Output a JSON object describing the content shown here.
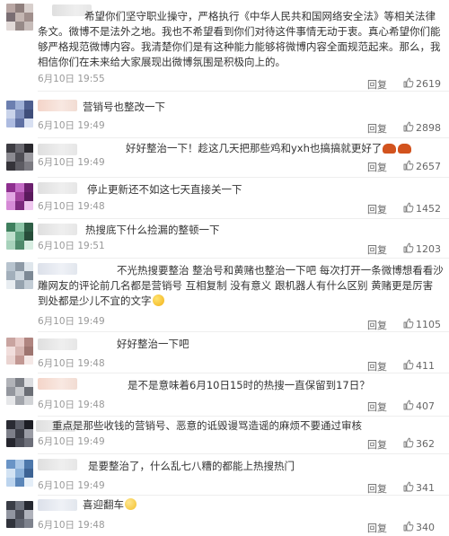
{
  "comments": [
    {
      "text": "希望你们坚守职业操守，严格执行《中华人民共和国网络安全法》等相关法律条文。微博不是法外之地。我也不希望看到你们对待这件事情无动于衷。真心希望你们能够严格规范微博内容。我清楚你们是有这种能力能够将微博内容全面规范起来。那么，我相信你们在未来给大家展现出微博氛围是积极向上的。",
      "time": "6月10日 19:55",
      "reply": "回复",
      "likes": "2619"
    },
    {
      "text": "营销号也整改一下",
      "time": "6月10日 19:49",
      "reply": "回复",
      "likes": "2898"
    },
    {
      "text": "好好整治一下！趁这几天把那些鸡和yxh也搞搞就更好了",
      "emoji": "crab-emoji",
      "time": "6月10日 19:49",
      "reply": "回复",
      "likes": "2657"
    },
    {
      "text": "停止更新还不如这七天直接关一下",
      "time": "6月10日 19:48",
      "reply": "回复",
      "likes": "1452"
    },
    {
      "text": "热搜底下什么捡漏的整顿一下",
      "time": "6月10日 19:51",
      "reply": "回复",
      "likes": "1203"
    },
    {
      "text": "不光热搜要整治 整治号和黄赌也整治一下吧 每次打开一条微博想看看沙雕网友的评论前几名都是营销号 互相复制 没有意义 跟机器人有什么区别 黄赌更是厉害 到处都是少儿不宜的文字",
      "emoji": "grin-emoji",
      "time": "6月10日 19:49",
      "reply": "回复",
      "likes": "1105"
    },
    {
      "text": "好好整治一下吧",
      "time": "6月10日 19:48",
      "reply": "回复",
      "likes": "411"
    },
    {
      "text": "是不是意味着6月10日15时的热搜一直保留到17日？",
      "time": "6月10日 19:48",
      "reply": "回复",
      "likes": "407"
    },
    {
      "text": "重点是那些收钱的营销号、恶意的诋毁谩骂造谣的麻烦不要通过审核",
      "time": "6月10日 19:49",
      "reply": "回复",
      "likes": "362"
    },
    {
      "text": "是要整治了，什么乱七八糟的都能上热搜热门",
      "time": "6月10日 19:49",
      "reply": "回复",
      "likes": "341"
    },
    {
      "text": "喜迎翻车",
      "emoji": "happy-emoji",
      "time": "6月10日 19:48",
      "reply": "回复",
      "likes": "340"
    }
  ],
  "theme": {
    "like_icon": "thumbs-up-icon",
    "avatar_colors": [
      [
        "#b9a7a4",
        "#8f7f7d",
        "#d8cfcc",
        "#7a6e73",
        "#c4b6b2",
        "#a08f8c",
        "#e2dad8",
        "#978a88",
        "#c7bcb9"
      ],
      [
        "#6c7fb0",
        "#9fb0d6",
        "#4e5f8f",
        "#c9d3ea",
        "#7f90bd",
        "#3f4e7a",
        "#adbbe0",
        "#5f70a3",
        "#d8e0f2"
      ],
      [
        "#3d3c42",
        "#6a6970",
        "#2a292e",
        "#8b8a91",
        "#4f4e55",
        "#9c9ba1",
        "#35343a",
        "#5d5c63",
        "#7c7b82"
      ],
      [
        "#8e2f8f",
        "#c46bc6",
        "#6b1f6d",
        "#e2a6e3",
        "#a3449f",
        "#5a1a5c",
        "#d58ad6",
        "#7d2b7e",
        "#efc7ef"
      ],
      [
        "#3f7f5e",
        "#8ec5a8",
        "#2f5f46",
        "#bfe0cd",
        "#5d9f7c",
        "#274d3a",
        "#a7d2bb",
        "#4e8a6b",
        "#d7ede1"
      ],
      [
        "#b7c3ce",
        "#8e9aa6",
        "#dfe6ec",
        "#a2afbb",
        "#cdd6de",
        "#7d8995",
        "#e8edf1",
        "#96a3af",
        "#c3cdd6"
      ],
      [
        "#c9a4a0",
        "#e6c9c6",
        "#b08580",
        "#f1dedc",
        "#d6b5b1",
        "#9e7570",
        "#ead4d1",
        "#c29893",
        "#f5e8e6"
      ],
      [
        "#b1b3b8",
        "#7c7f86",
        "#dcdde0",
        "#94979e",
        "#c6c8cc",
        "#6b6e75",
        "#e6e7e9",
        "#a3a6ac",
        "#d1d3d6"
      ],
      [
        "#2a2b33",
        "#5a5c66",
        "#1c1d24",
        "#7d7f89",
        "#3c3e47",
        "#9a9ca5",
        "#25262e",
        "#4d4f59",
        "#6c6e78"
      ],
      [
        "#6a94c6",
        "#a9c6e6",
        "#4d78ab",
        "#d3e3f3",
        "#8ab0d9",
        "#3d6394",
        "#bcd4ee",
        "#5b86b9",
        "#e4eef8"
      ],
      [
        "#3a3d46",
        "#6e727d",
        "#262830",
        "#9195a0",
        "#4c4f59",
        "#b0b3bc",
        "#30333b",
        "#5e626d",
        "#7e828d"
      ]
    ]
  }
}
